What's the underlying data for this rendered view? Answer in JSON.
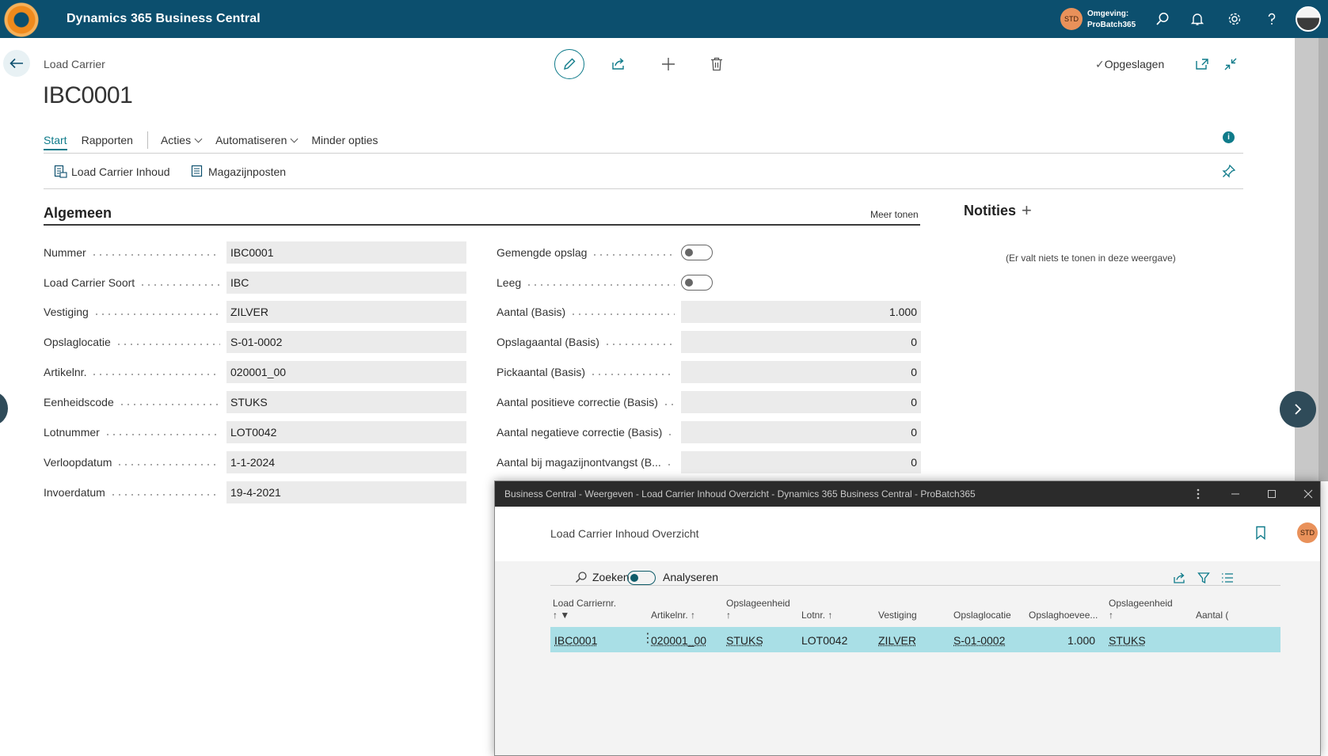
{
  "appbar": {
    "title": "Dynamics 365 Business Central",
    "env_avatar": "STD",
    "env_label": "Omgeving:",
    "env_name": "ProBatch365",
    "icons": [
      "search-icon",
      "bell-icon",
      "gear-icon",
      "help-icon"
    ]
  },
  "header": {
    "entity_type": "Load Carrier",
    "record_title": "IBC0001",
    "saved_label": "Opgeslagen"
  },
  "actions": {
    "tabs": [
      {
        "label": "Start"
      },
      {
        "label": "Rapporten"
      },
      {
        "label": "Acties"
      },
      {
        "label": "Automatiseren"
      },
      {
        "label": "Minder opties"
      }
    ],
    "promoted": [
      {
        "label": "Load Carrier Inhoud"
      },
      {
        "label": "Magazijnposten"
      }
    ]
  },
  "general": {
    "title": "Algemeen",
    "show_more": "Meer tonen",
    "left_fields": [
      {
        "label": "Nummer",
        "value": "IBC0001"
      },
      {
        "label": "Load Carrier Soort",
        "value": "IBC"
      },
      {
        "label": "Vestiging",
        "value": "ZILVER"
      },
      {
        "label": "Opslaglocatie",
        "value": "S-01-0002"
      },
      {
        "label": "Artikelnr.",
        "value": "020001_00"
      },
      {
        "label": "Eenheidscode",
        "value": "STUKS"
      },
      {
        "label": "Lotnummer",
        "value": "LOT0042"
      },
      {
        "label": "Verloopdatum",
        "value": "1-1-2024"
      },
      {
        "label": "Invoerdatum",
        "value": "19-4-2021"
      }
    ],
    "toggles": [
      {
        "label": "Gemengde opslag",
        "on": false
      },
      {
        "label": "Leeg",
        "on": false
      }
    ],
    "right_fields": [
      {
        "label": "Aantal (Basis)",
        "value": "1.000"
      },
      {
        "label": "Opslagaantal (Basis)",
        "value": "0"
      },
      {
        "label": "Pickaantal (Basis)",
        "value": "0"
      },
      {
        "label": "Aantal positieve correctie (Basis)",
        "value": "0"
      },
      {
        "label": "Aantal negatieve correctie (Basis)",
        "value": "0"
      },
      {
        "label": "Aantal bij magazijnontvangst (B...",
        "value": "0"
      }
    ]
  },
  "notes": {
    "title": "Notities",
    "empty": "(Er valt niets te tonen in deze weergave)"
  },
  "popup": {
    "window_title": "Business Central - Weergeven - Load Carrier Inhoud Overzicht - Dynamics 365 Business Central - ProBatch365",
    "caption": "Load Carrier Inhoud Overzicht",
    "avatar": "STD",
    "search_label": "Zoeken",
    "analyze_label": "Analyseren",
    "columns": [
      {
        "line1": "Load Carriernr.",
        "line2": "↑"
      },
      {
        "line1": "Artikelnr. ↑",
        "line2": ""
      },
      {
        "line1": "Opslageenheid",
        "line2": "↑"
      },
      {
        "line1": "Lotnr. ↑",
        "line2": ""
      },
      {
        "line1": "Vestiging",
        "line2": ""
      },
      {
        "line1": "Opslaglocatie",
        "line2": ""
      },
      {
        "line1": "Opslaghoevee...",
        "line2": ""
      },
      {
        "line1": "Opslageenheid",
        "line2": "↑"
      },
      {
        "line1": "Aantal (",
        "line2": ""
      }
    ],
    "rows": [
      {
        "load_carrier": "IBC0001",
        "item": "020001_00",
        "unit": "STUKS",
        "lot": "LOT0042",
        "location": "ZILVER",
        "bin": "S-01-0002",
        "qty": "1.000",
        "unit2": "STUKS"
      }
    ]
  },
  "colors": {
    "appbar": "#0c4f6e",
    "accent": "#0f7b8a",
    "row_selected": "#a9dfe6",
    "avatar": "#e9915a"
  }
}
